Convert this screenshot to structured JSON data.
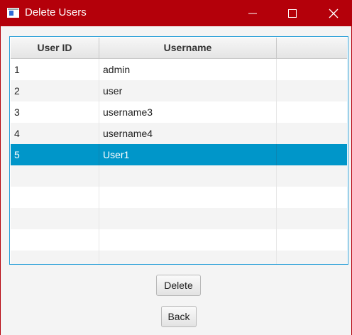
{
  "window": {
    "title": "Delete Users",
    "controls": [
      "minimize-icon",
      "maximize-icon",
      "close-icon"
    ],
    "accent_color": "#b4000a"
  },
  "table": {
    "columns": [
      "User ID",
      "Username",
      ""
    ],
    "rows": [
      {
        "id": "1",
        "username": "admin"
      },
      {
        "id": "2",
        "username": "user"
      },
      {
        "id": "3",
        "username": "username3"
      },
      {
        "id": "4",
        "username": "username4"
      },
      {
        "id": "5",
        "username": "User1"
      }
    ],
    "selected_row": 4,
    "selection_color": "#0096c9"
  },
  "buttons": {
    "delete_label": "Delete",
    "back_label": "Back"
  }
}
